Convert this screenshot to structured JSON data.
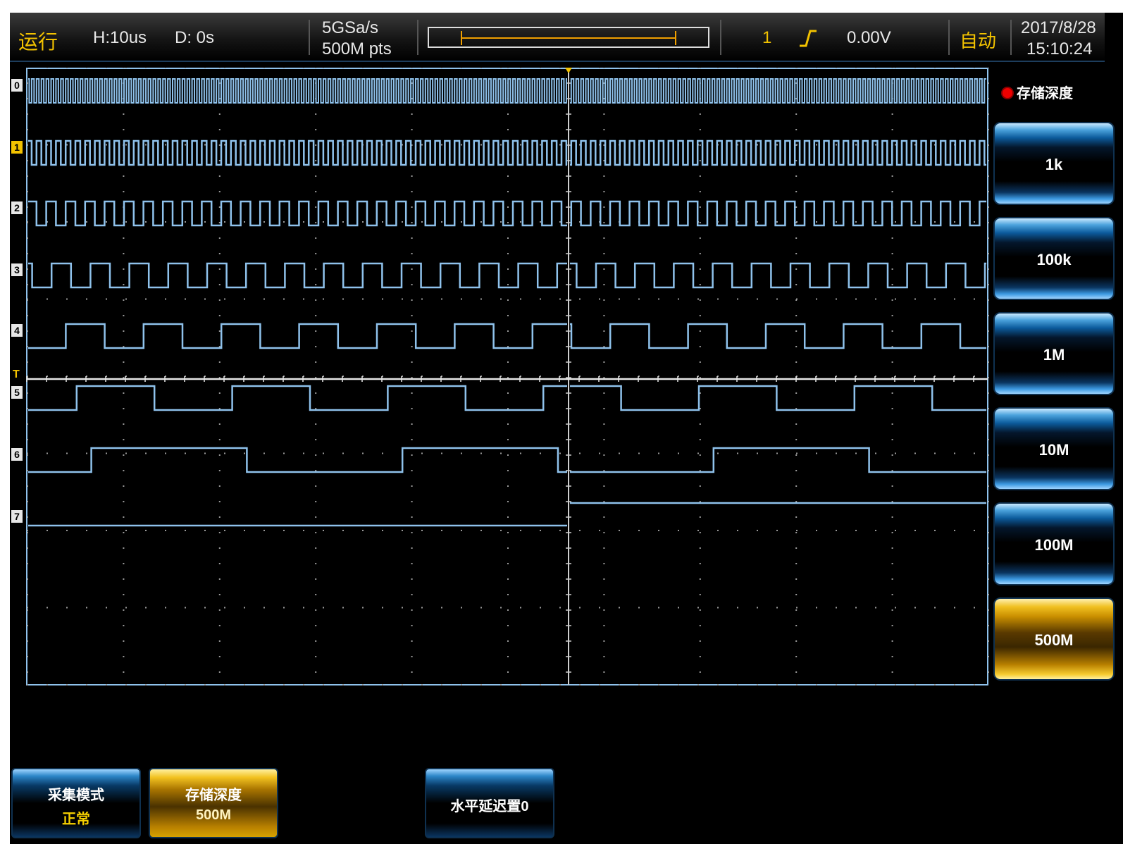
{
  "status_bar": {
    "run_state": "运行",
    "h_scale": "H:10us",
    "delay": "D: 0s",
    "sample_rate": "5GSa/s",
    "memory_points": "500M pts",
    "trigger_source": "1",
    "trigger_edge_icon": "rising-edge-icon",
    "trigger_level": "0.00V",
    "trigger_mode": "自动",
    "date": "2017/8/28",
    "time": "15:10:24"
  },
  "channels": [
    "0",
    "1",
    "2",
    "3",
    "4",
    "5",
    "6",
    "7"
  ],
  "trigger_marker": "T",
  "side_menu": {
    "title": "存储深度",
    "options": [
      "1k",
      "100k",
      "1M",
      "10M",
      "100M",
      "500M"
    ],
    "selected": "500M"
  },
  "bottom_menu": {
    "acq_mode_label": "采集模式",
    "acq_mode_value": "正常",
    "mem_depth_label": "存储深度",
    "mem_depth_value": "500M",
    "h_delay_label": "水平延迟置0"
  },
  "colors": {
    "trace": "#8fc2ec",
    "grid": "#9a9a9a",
    "accent": "#f2c200",
    "selected": "#e0a800"
  }
}
